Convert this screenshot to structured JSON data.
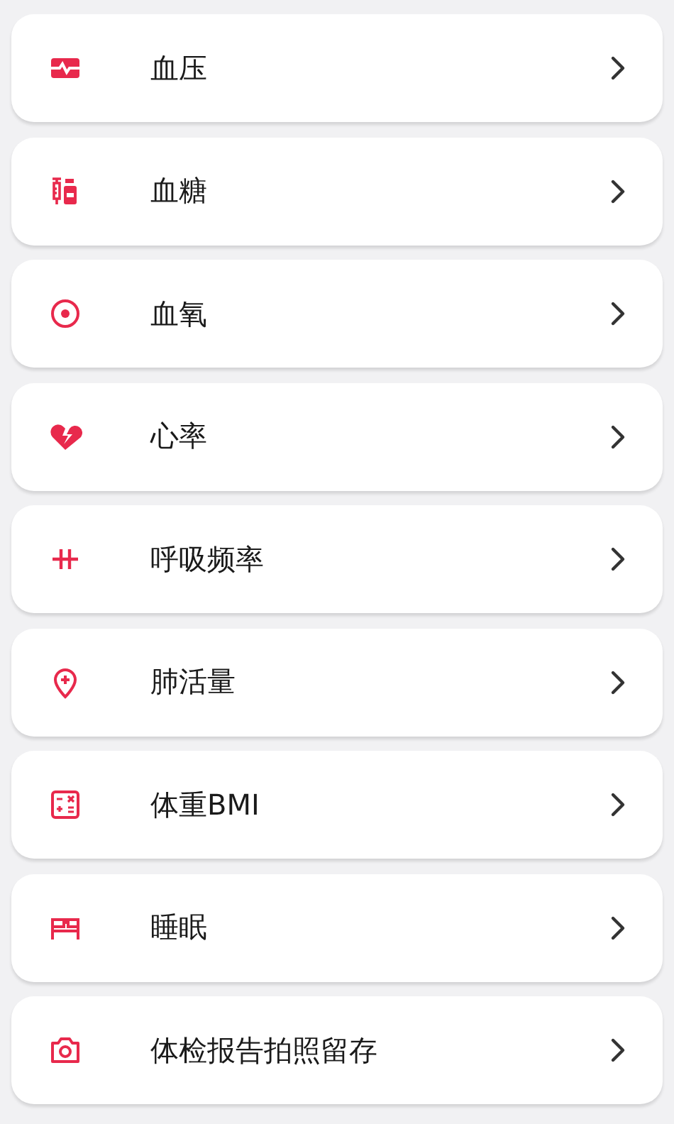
{
  "items": [
    {
      "label": "血压",
      "kind": "pressure"
    },
    {
      "label": "血糖",
      "kind": "syringe"
    },
    {
      "label": "血氧",
      "kind": "target"
    },
    {
      "label": "心率",
      "kind": "heart"
    },
    {
      "label": "呼吸频率",
      "kind": "breath"
    },
    {
      "label": "肺活量",
      "kind": "pin"
    },
    {
      "label": "体重BMI",
      "kind": "calculator"
    },
    {
      "label": "睡眠",
      "kind": "bed"
    },
    {
      "label": "体检报告拍照留存",
      "kind": "camera"
    }
  ]
}
